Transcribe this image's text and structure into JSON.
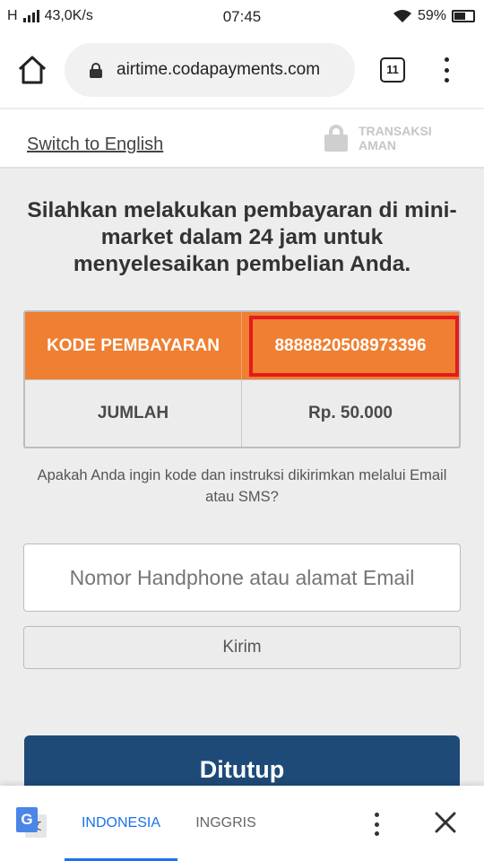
{
  "status_bar": {
    "network": "H",
    "speed": "43,0K/s",
    "time": "07:45",
    "battery": "59%"
  },
  "browser": {
    "url": "airtime.codapayments.com",
    "tab_count": "11"
  },
  "header": {
    "switch_language": "Switch to English",
    "secure_line1": "TRANSAKSI",
    "secure_line2": "AMAN"
  },
  "main": {
    "instruction": "Silahkan melakukan pembayaran di mini-market dalam 24 jam untuk menyelesaikan pembelian Anda.",
    "payment_code_label": "KODE PEMBAYARAN",
    "payment_code_value": "8888820508973396",
    "amount_label": "JUMLAH",
    "amount_value": "Rp. 50.000",
    "question": "Apakah Anda ingin kode dan instruksi dikirimkan melalui Email atau SMS?",
    "contact_placeholder": "Nomor Handphone atau alamat Email",
    "send_label": "Kirim",
    "close_label": "Ditutup"
  },
  "translate_bar": {
    "lang_source": "INDONESIA",
    "lang_target": "INGGRIS"
  },
  "colors": {
    "orange": "#ef7f31",
    "navy": "#1e4a78",
    "highlight_red": "#e31b1b",
    "google_blue": "#1a73e8"
  }
}
